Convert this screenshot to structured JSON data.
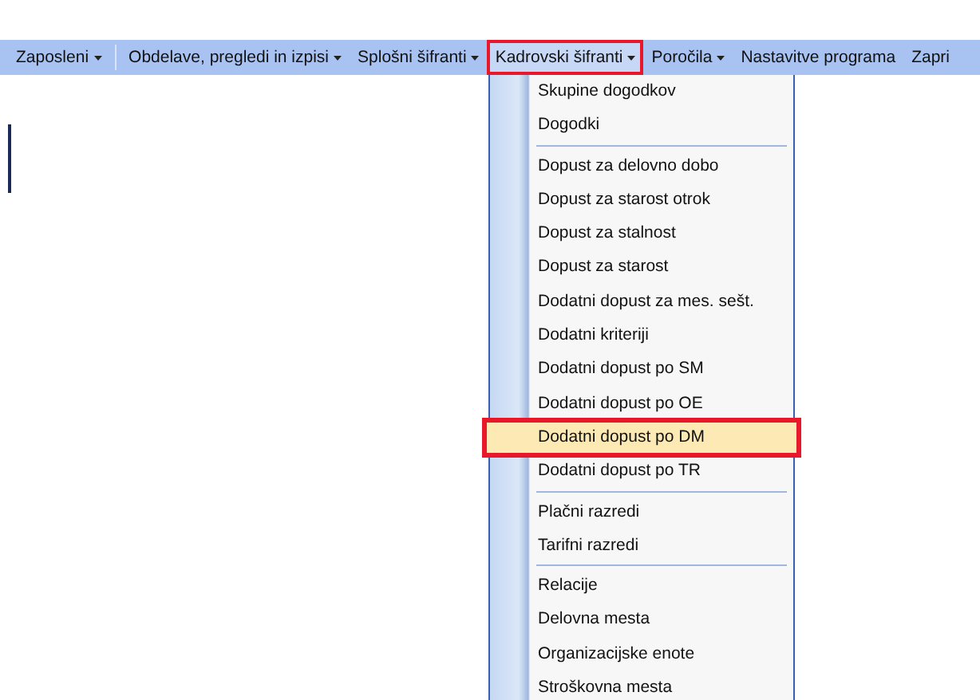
{
  "menu_bar": [
    {
      "kind": "menu",
      "label": "Zaposleni",
      "arrow": true,
      "selected": false
    },
    {
      "kind": "separator"
    },
    {
      "kind": "menu",
      "label": "Obdelave, pregledi in izpisi",
      "arrow": true,
      "selected": false
    },
    {
      "kind": "menu",
      "label": "Splošni šifranti",
      "arrow": true,
      "selected": false
    },
    {
      "kind": "menu",
      "label": "Kadrovski šifranti",
      "arrow": true,
      "selected": true
    },
    {
      "kind": "menu",
      "label": "Poročila",
      "arrow": true,
      "selected": false
    },
    {
      "kind": "menu",
      "label": "Nastavitve programa",
      "arrow": false,
      "selected": false
    },
    {
      "kind": "menu",
      "label": "Zapri",
      "arrow": false,
      "selected": false
    }
  ],
  "dropdown": [
    {
      "kind": "item",
      "label": "Skupine dogodkov",
      "selected": false
    },
    {
      "kind": "item",
      "label": "Dogodki",
      "selected": false
    },
    {
      "kind": "separator"
    },
    {
      "kind": "item",
      "label": "Dopust za delovno dobo",
      "selected": false
    },
    {
      "kind": "item",
      "label": "Dopust za starost otrok",
      "selected": false
    },
    {
      "kind": "item",
      "label": "Dopust za stalnost",
      "selected": false
    },
    {
      "kind": "item",
      "label": "Dopust za starost",
      "selected": false
    },
    {
      "kind": "item",
      "label": "Dodatni dopust za mes. sešt.",
      "selected": false
    },
    {
      "kind": "item",
      "label": "Dodatni kriteriji",
      "selected": false
    },
    {
      "kind": "item",
      "label": "Dodatni dopust po SM",
      "selected": false
    },
    {
      "kind": "item",
      "label": "Dodatni dopust po OE",
      "selected": false
    },
    {
      "kind": "item",
      "label": "Dodatni dopust po DM",
      "selected": true
    },
    {
      "kind": "item",
      "label": "Dodatni dopust po TR",
      "selected": false
    },
    {
      "kind": "separator"
    },
    {
      "kind": "item",
      "label": "Plačni razredi",
      "selected": false
    },
    {
      "kind": "item",
      "label": "Tarifni razredi",
      "selected": false
    },
    {
      "kind": "separator"
    },
    {
      "kind": "item",
      "label": "Relacije",
      "selected": false
    },
    {
      "kind": "item",
      "label": "Delovna mesta",
      "selected": false
    },
    {
      "kind": "item",
      "label": "Organizacijske enote",
      "selected": false
    },
    {
      "kind": "item",
      "label": "Stroškovna mesta",
      "selected": false
    }
  ]
}
